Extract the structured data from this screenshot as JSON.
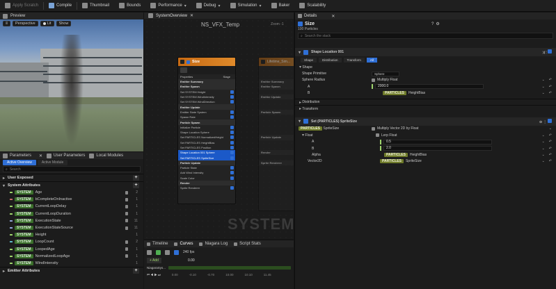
{
  "toolbar": {
    "items": [
      {
        "icon": "apply-scratch-icon",
        "label": "Apply Scratch"
      },
      {
        "icon": "compile-icon",
        "label": "Compile"
      },
      {
        "icon": "thumbnail-icon",
        "label": "Thumbnail"
      },
      {
        "icon": "bounds-icon",
        "label": "Bounds"
      },
      {
        "icon": "performance-icon",
        "label": "Performance"
      },
      {
        "icon": "debug-icon",
        "label": "Debug"
      },
      {
        "icon": "simulation-icon",
        "label": "Simulation"
      },
      {
        "icon": "baker-icon",
        "label": "Baker"
      },
      {
        "icon": "scalability-icon",
        "label": "Scalability"
      }
    ]
  },
  "preview": {
    "tab": "Preview",
    "buttons": {
      "perspective": "Perspective",
      "lit": "Lit",
      "show": "Show"
    }
  },
  "params": {
    "tabs": [
      "Parameters",
      "User Parameters",
      "Local Modules"
    ],
    "subtabs": {
      "active": "Active Overview",
      "other": "Active Module"
    },
    "search_placeholder": "Search",
    "user_exposed": "User Exposed",
    "system_attributes": "System Attributes",
    "emitter_attributes": "Emitter Attributes",
    "tag": "SYSTEM",
    "rows": [
      {
        "name": "Age",
        "count": "2"
      },
      {
        "name": "bCompleteOnInactive",
        "count": "1"
      },
      {
        "name": "CurrentLoopDelay",
        "count": "1"
      },
      {
        "name": "CurrentLoopDuration",
        "count": "1"
      },
      {
        "name": "ExecutionState",
        "count": "11"
      },
      {
        "name": "ExecutionStateSource",
        "count": "11"
      },
      {
        "name": "Height",
        "count": "1"
      },
      {
        "name": "LoopCount",
        "count": "2"
      },
      {
        "name": "LoopedAge",
        "count": "1"
      },
      {
        "name": "NormalizedLoopAge",
        "count": "1"
      },
      {
        "name": "WindIntensity",
        "count": "1"
      }
    ]
  },
  "graph": {
    "tab": "SystemOverview",
    "title": "NS_VFX_Temp",
    "zoom": "Zoom -1",
    "watermark": "SYSTEM",
    "node_title": "Size",
    "node_top": {
      "properties": "Properties",
      "stage": "Stage"
    },
    "node2_title": "Lifetime_Sim...",
    "rows": [
      {
        "kind": "section",
        "label": "Emitter Summary"
      },
      {
        "kind": "section",
        "label": "Emitter Spawn"
      },
      {
        "kind": "item",
        "label": "Set  SYSTEM  Height"
      },
      {
        "kind": "item",
        "label": "Set  SYSTEM  WindIntensity"
      },
      {
        "kind": "item",
        "label": "Set  SYSTEM  WindDirection"
      },
      {
        "kind": "section",
        "label": "Emitter Update"
      },
      {
        "kind": "item",
        "label": "Emitter State  System"
      },
      {
        "kind": "item",
        "label": "Spawn Rate"
      },
      {
        "kind": "section",
        "label": "Particle Spawn"
      },
      {
        "kind": "item",
        "label": "Initialize Particle"
      },
      {
        "kind": "item",
        "label": "Shape Location  Sphere"
      },
      {
        "kind": "item",
        "label": "Set  PARTICLES  NormalizedHeight"
      },
      {
        "kind": "item",
        "label": "Set  PARTICLES  HeightBias"
      },
      {
        "kind": "item",
        "label": "Set  PARTICLES  Position"
      },
      {
        "kind": "selected",
        "label": "Shape Location 001  Sphere"
      },
      {
        "kind": "selected",
        "label": "Set  PARTICLES  SpriteSize"
      },
      {
        "kind": "section",
        "label": "Particle Update"
      },
      {
        "kind": "item",
        "label": "Particle State"
      },
      {
        "kind": "item",
        "label": "Add Wind Intensity"
      },
      {
        "kind": "item",
        "label": "Scale Color"
      },
      {
        "kind": "section",
        "label": "Render"
      },
      {
        "kind": "item",
        "label": "Sprite Renderer"
      }
    ],
    "node2_rows": [
      "Emitter Summary",
      "Emitter Spawn",
      "",
      "Emitter Update",
      "",
      "",
      "Particle Spawn",
      "",
      "",
      "",
      "",
      "Particle Update",
      "",
      "",
      "Render",
      "",
      "Sprite Renderer"
    ]
  },
  "timeline": {
    "tabs": [
      "Timeline",
      "Curves",
      "Niagara Log",
      "Script Stats"
    ],
    "add_label": "+ Add",
    "fps": "240 fps",
    "time_display": "0.00",
    "track": "NiagaraSys...",
    "ticks": [
      "0.00",
      "-0.10",
      "-0.70",
      "10.00",
      "10.10",
      "11.45"
    ]
  },
  "details": {
    "tab": "Details",
    "title": "Size",
    "subtitle": "100 Particles",
    "search_placeholder": "Search the stack",
    "shape_module": "Shape Location 001",
    "shape_tabs": [
      "Shape",
      "Distribution",
      "Transform",
      "All"
    ],
    "shape_section": "Shape",
    "shape_primitive_label": "Shape Primitive",
    "shape_primitive_value": "Sphere",
    "sphere_radius_label": "Sphere Radius",
    "multiply_float": "Multiply Float",
    "a_label": "A",
    "a_value": "2000.0",
    "b_label": "B",
    "particles_tag": "PARTICLES",
    "b_value": "HeightBias",
    "distribution": "Distribution",
    "transform": "Transform",
    "set_module": "Set (PARTICLES) SpriteSize",
    "sprite_size": "SpriteSize",
    "multiply_vector": "Multiply Vector 2D by Float",
    "float_label": "Float",
    "lerp_float": "Lerp Float",
    "lerp_a": "0.5",
    "lerp_b": "2.0",
    "alpha_label": "Alpha",
    "alpha_value": "HeightBias",
    "vector2d_label": "Vector2D",
    "vector2d_value": "SpriteSize"
  }
}
